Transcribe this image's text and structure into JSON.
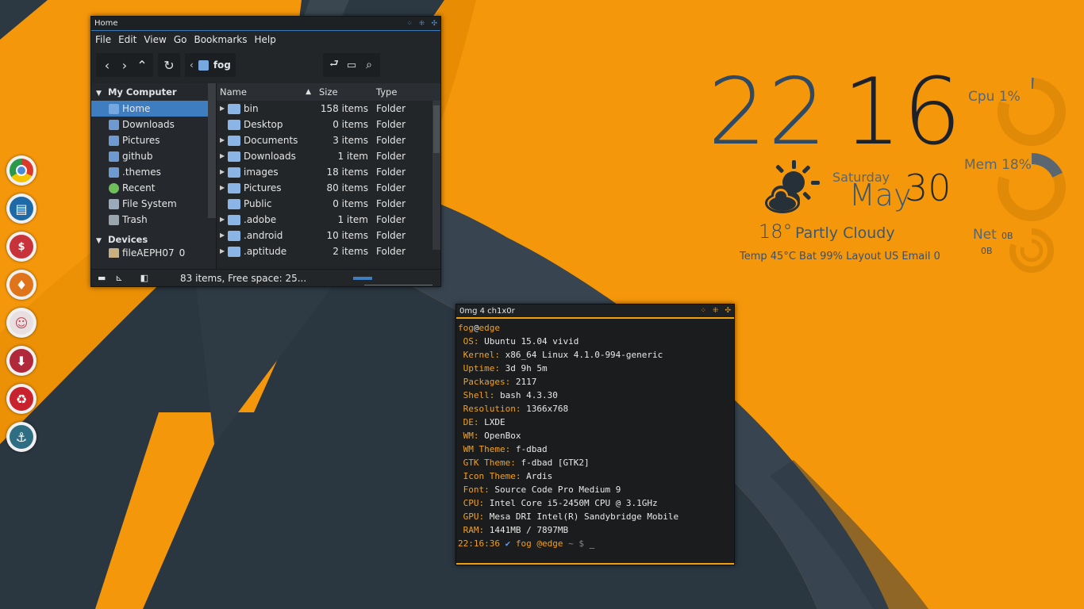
{
  "file_manager": {
    "title": "Home",
    "menu": [
      "File",
      "Edit",
      "View",
      "Go",
      "Bookmarks",
      "Help"
    ],
    "path": "fog",
    "sidebar": {
      "section1": "My Computer",
      "items": [
        "Home",
        "Downloads",
        "Pictures",
        "github",
        ".themes",
        "Recent",
        "File System",
        "Trash"
      ],
      "section2": "Devices",
      "device": "fileAEPH07_0"
    },
    "columns": {
      "name": "Name",
      "size": "Size",
      "type": "Type"
    },
    "rows": [
      {
        "name": "bin",
        "size": "158 items",
        "type": "Folder"
      },
      {
        "name": "Desktop",
        "size": "0 items",
        "type": "Folder"
      },
      {
        "name": "Documents",
        "size": "3 items",
        "type": "Folder"
      },
      {
        "name": "Downloads",
        "size": "1 item",
        "type": "Folder"
      },
      {
        "name": "images",
        "size": "18 items",
        "type": "Folder"
      },
      {
        "name": "Pictures",
        "size": "80 items",
        "type": "Folder"
      },
      {
        "name": "Public",
        "size": "0 items",
        "type": "Folder"
      },
      {
        "name": ".adobe",
        "size": "1 item",
        "type": "Folder"
      },
      {
        "name": ".android",
        "size": "10 items",
        "type": "Folder"
      },
      {
        "name": ".aptitude",
        "size": "2 items",
        "type": "Folder"
      }
    ],
    "status": "83 items, Free space: 25..."
  },
  "terminal": {
    "title": "0mg 4 ch1x0r",
    "user": "fog",
    "host": "edge",
    "info": [
      {
        "k": "OS:",
        "v": "Ubuntu 15.04 vivid"
      },
      {
        "k": "Kernel:",
        "v": "x86_64 Linux 4.1.0-994-generic"
      },
      {
        "k": "Uptime:",
        "v": "3d 9h 5m"
      },
      {
        "k": "Packages:",
        "v": "2117"
      },
      {
        "k": "Shell:",
        "v": "bash 4.3.30"
      },
      {
        "k": "Resolution:",
        "v": "1366x768"
      },
      {
        "k": "DE:",
        "v": "LXDE"
      },
      {
        "k": "WM:",
        "v": "OpenBox"
      },
      {
        "k": "WM Theme:",
        "v": "f-dbad"
      },
      {
        "k": "GTK Theme:",
        "v": "f-dbad [GTK2]"
      },
      {
        "k": "Icon Theme:",
        "v": "Ardis"
      },
      {
        "k": "Font:",
        "v": "Source Code Pro Medium 9"
      },
      {
        "k": "CPU:",
        "v": "Intel Core i5-2450M CPU @ 3.1GHz"
      },
      {
        "k": "GPU:",
        "v": "Mesa DRI Intel(R) Sandybridge Mobile"
      },
      {
        "k": "RAM:",
        "v": "1441MB / 7897MB"
      }
    ],
    "prompt_time": "22:16:36",
    "prompt_check": "✔",
    "prompt_user": "fog",
    "prompt_at": "@edge",
    "prompt_tail": "~ $"
  },
  "conky": {
    "hour": "22",
    "minute": "16",
    "weekday": "Saturday",
    "month": "May",
    "day": "30",
    "temp": "18°",
    "condition": "Partly Cloudy",
    "stats_line": "Temp 45°C Bat 99% Layout US Email 0",
    "cpu_label": "Cpu 1%",
    "mem_label": "Mem 18%",
    "net_label": "Net",
    "net_up": "0B",
    "net_down": "0B",
    "cpu_pct": 1,
    "mem_pct": 18
  },
  "dock": [
    "chrome-icon",
    "files-icon",
    "money-icon",
    "fire-icon",
    "cat-icon",
    "download-icon",
    "recycle-icon",
    "anchor-icon"
  ],
  "colors": {
    "accent_orange": "#f5970a",
    "fm_blue": "#3d7dc0",
    "dark": "#263038"
  }
}
